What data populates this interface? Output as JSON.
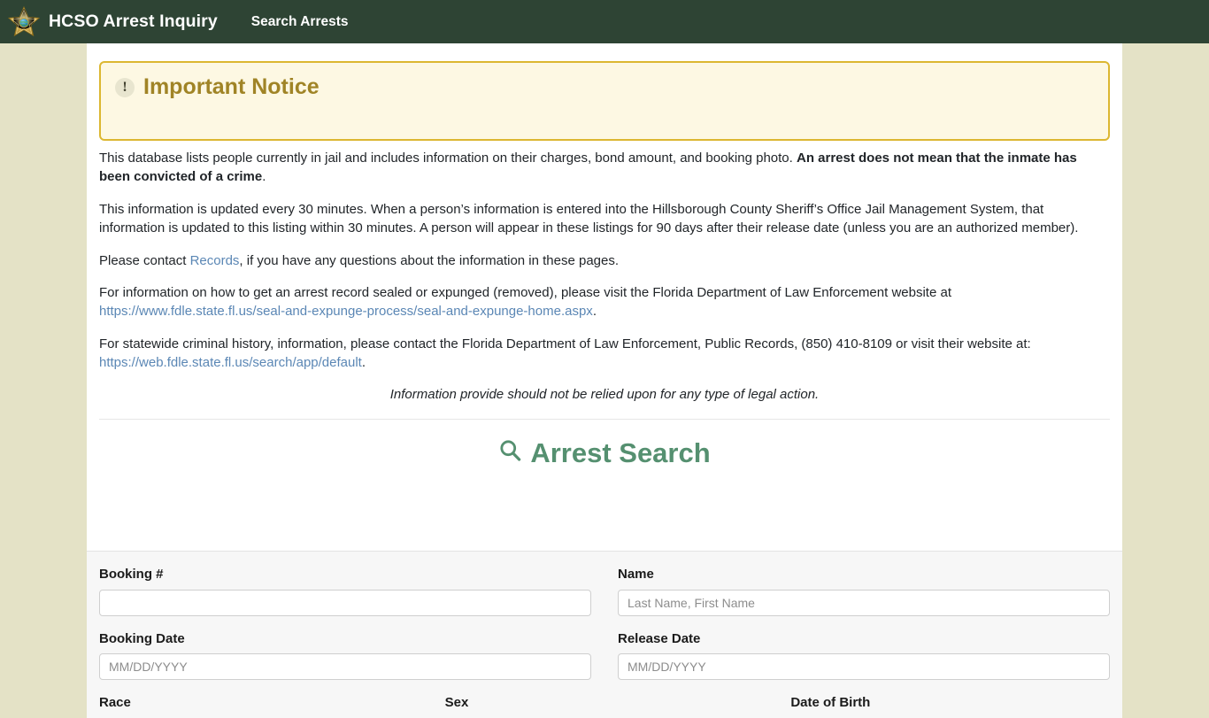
{
  "navbar": {
    "logo_icon": "sheriff-star-badge-icon",
    "brand": "HCSO Arrest Inquiry",
    "links": [
      {
        "label": "Search Arrests"
      }
    ]
  },
  "notice": {
    "icon": "exclamation-circle-icon",
    "title": "Important Notice"
  },
  "content": {
    "paragraph1_part1": "This database lists people currently in jail and includes information on their charges, bond amount, and booking photo. ",
    "paragraph1_bold": "An arrest does not mean that the inmate has been convicted of a crime",
    "paragraph1_part2": ".",
    "paragraph2": "This information is updated every 30 minutes. When a person’s information is entered into the Hillsborough County Sheriff’s Office Jail Management System, that information is updated to this listing within 30 minutes. A person will appear in these listings for 90 days after their release date (unless you are an authorized member).",
    "paragraph3_part1": "Please contact ",
    "paragraph3_link": "Records",
    "paragraph3_part2": ", if you have any questions about the information in these pages.",
    "paragraph4_part1": "For information on how to get an arrest record sealed or expunged (removed), please visit the Florida Department of Law Enforcement website at ",
    "paragraph4_link": "https://www.fdle.state.fl.us/seal-and-expunge-process/seal-and-expunge-home.aspx",
    "paragraph4_part2": ".",
    "paragraph5_part1": "For statewide criminal history, information, please contact the Florida Department of Law Enforcement, Public Records, (850) 410-8109 or visit their website at: ",
    "paragraph5_link": "https://web.fdle.state.fl.us/search/app/default",
    "paragraph5_part2": ".",
    "disclaimer": "Information provide should not be relied upon for any type of legal action."
  },
  "search": {
    "icon": "magnifier-icon",
    "heading": "Arrest Search",
    "fields": {
      "booking_number": {
        "label": "Booking #",
        "value": "",
        "placeholder": ""
      },
      "name": {
        "label": "Name",
        "value": "",
        "placeholder": "Last Name, First Name"
      },
      "booking_date": {
        "label": "Booking Date",
        "value": "",
        "placeholder": "MM/DD/YYYY"
      },
      "release_date": {
        "label": "Release Date",
        "value": "",
        "placeholder": "MM/DD/YYYY"
      },
      "race": {
        "label": "Race"
      },
      "sex": {
        "label": "Sex"
      },
      "date_of_birth": {
        "label": "Date of Birth"
      }
    }
  },
  "colors": {
    "navbar_bg": "#2e4434",
    "page_bg": "#e4e2c6",
    "notice_border": "#dcb731",
    "notice_bg": "#fdf8e3",
    "notice_text": "#a08426",
    "heading_green": "#559070",
    "link_blue": "#5b87b5",
    "panel_bg": "#f7f7f7"
  }
}
